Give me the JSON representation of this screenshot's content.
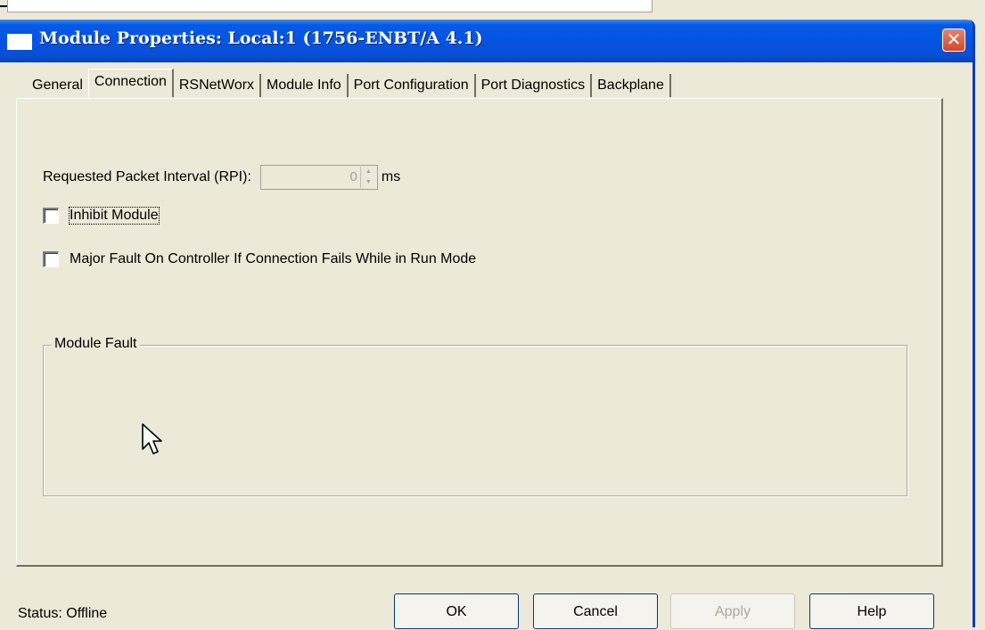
{
  "dialog": {
    "title": "Module Properties: Local:1 (1756-ENBT/A 4.1)",
    "close_glyph": "✕"
  },
  "tabs": [
    {
      "label": "General"
    },
    {
      "label": "Connection",
      "active": true
    },
    {
      "label": "RSNetWorx"
    },
    {
      "label": "Module Info"
    },
    {
      "label": "Port Configuration"
    },
    {
      "label": "Port Diagnostics"
    },
    {
      "label": "Backplane"
    }
  ],
  "connection": {
    "rpi_label": "Requested Packet Interval (RPI):",
    "rpi_value": "0",
    "rpi_unit": "ms",
    "inhibit_label": "Inhibit Module",
    "inhibit_checked": false,
    "major_fault_label": "Major Fault On Controller If Connection Fails While in Run Mode",
    "major_fault_checked": false,
    "module_fault_group": "Module Fault"
  },
  "footer": {
    "status": "Status:  Offline",
    "ok": "OK",
    "cancel": "Cancel",
    "apply": "Apply",
    "help": "Help"
  },
  "colors": {
    "titlebar": "#0454e2",
    "dialog_bg": "#ece9d8",
    "close": "#d4482a"
  }
}
